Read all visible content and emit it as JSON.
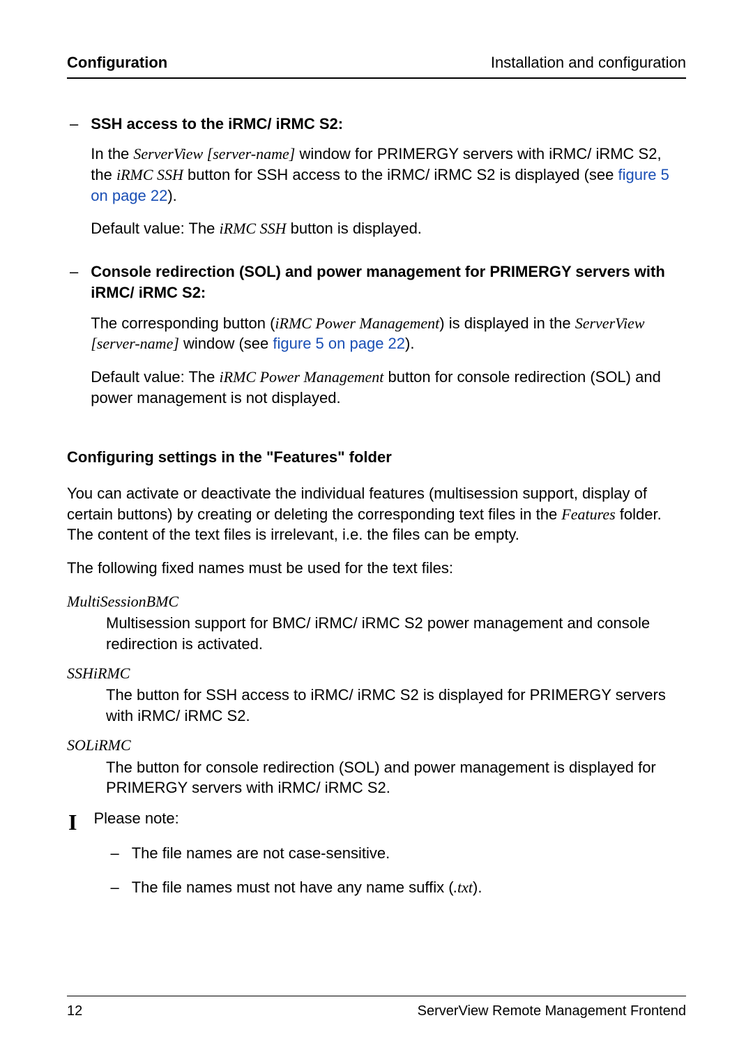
{
  "header": {
    "left": "Configuration",
    "right": "Installation and configuration"
  },
  "section1": {
    "title": "SSH access to the iRMC/ iRMC S2:",
    "p1_a": "In the ",
    "p1_i1": "ServerView [server-name]",
    "p1_b": " window for PRIMERGY servers with iRMC/ iRMC S2, the ",
    "p1_i2": "iRMC SSH",
    "p1_c": " button for SSH access to the iRMC/ iRMC S2 is displayed (see ",
    "p1_link": "figure 5 on page 22",
    "p1_d": ").",
    "p2_a": "Default value: The ",
    "p2_i": "iRMC SSH",
    "p2_b": " button is displayed."
  },
  "section2": {
    "title": "Console redirection (SOL) and power management for PRIMERGY servers with iRMC/ iRMC S2:",
    "p1_a": "The corresponding button (",
    "p1_i1": "iRMC Power Management",
    "p1_b": ") is displayed in the ",
    "p1_i2": "ServerView [server-name]",
    "p1_c": " window (see ",
    "p1_link": "figure 5 on page 22",
    "p1_d": ").",
    "p2_a": "Default value: The ",
    "p2_i": "iRMC Power Management",
    "p2_b": " button for console redirection (SOL) and power management is not displayed."
  },
  "heading": "Configuring settings in the \"Features\" folder",
  "intro_a": "You can activate or deactivate the individual features (multisession support, display of certain buttons) by creating or deleting the corresponding text files in the ",
  "intro_i": "Features",
  "intro_b": " folder. The content of the text files is irrelevant, i.e. the files can be empty.",
  "intro2": "The following fixed names must be used for the text files:",
  "defs": {
    "t1": "MultiSessionBMC",
    "d1": "Multisession support for BMC/ iRMC/ iRMC S2 power management and console redirection is activated.",
    "t2": "SSHiRMC",
    "d2": "The button for SSH access to iRMC/ iRMC S2 is displayed for PRIMERGY servers with iRMC/ iRMC S2.",
    "t3": "SOLiRMC",
    "d3": "The button for console redirection (SOL) and power management is displayed for PRIMERGY servers with iRMC/ iRMC S2."
  },
  "note": {
    "lead": "Please note:",
    "b1": "The file names are not case-sensitive.",
    "b2_a": "The file names must not have any name suffix (",
    "b2_i": ".txt",
    "b2_b": ")."
  },
  "footer": {
    "page": "12",
    "right": "ServerView Remote Management Frontend"
  }
}
